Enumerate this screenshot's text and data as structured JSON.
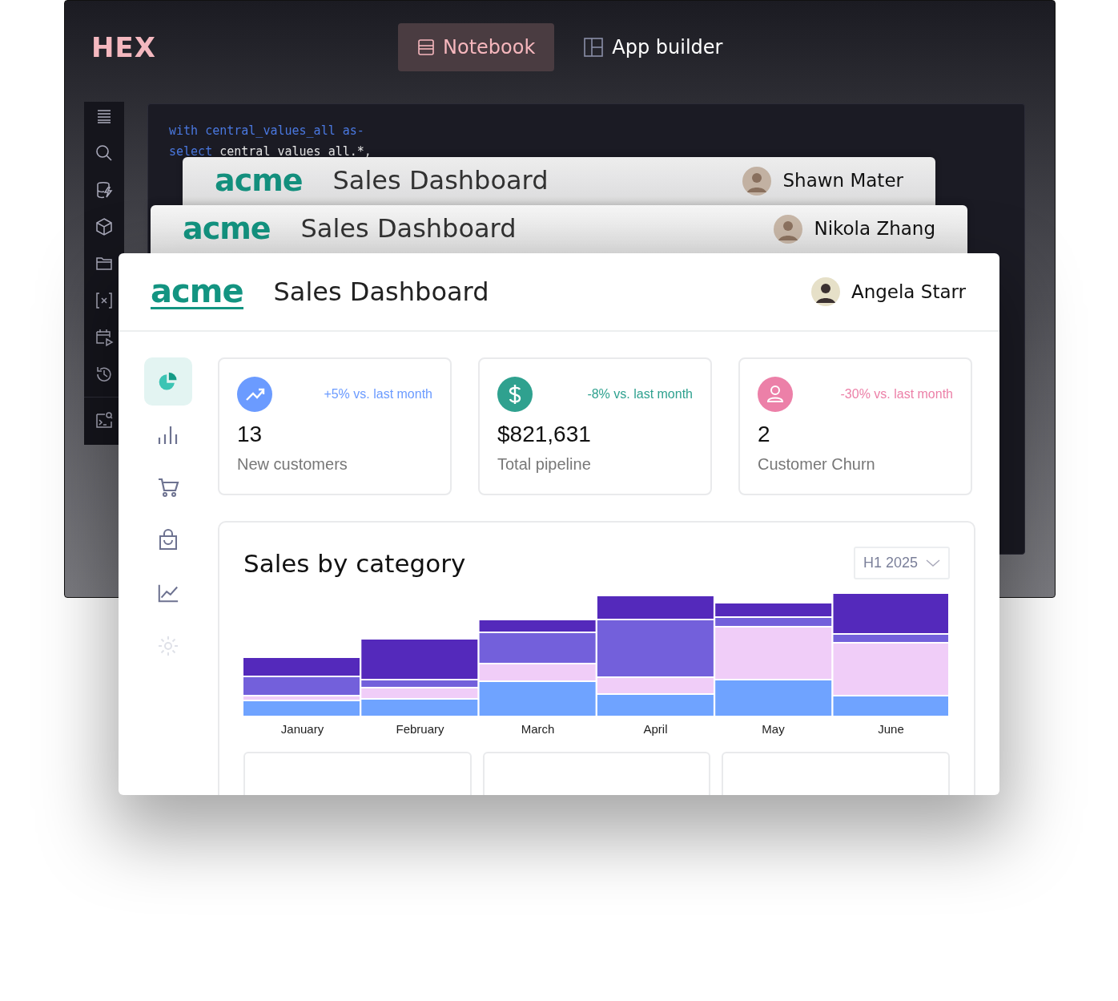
{
  "app": {
    "logo": "HEX",
    "tabs": [
      {
        "label": "Notebook",
        "selected": true
      },
      {
        "label": "App builder",
        "selected": false
      }
    ],
    "code_lines": [
      {
        "keyword": "with",
        "rest": "central_values_all as-"
      },
      {
        "keyword": "select",
        "rest": "central_values_all.*,"
      }
    ]
  },
  "stacked_windows": [
    {
      "logo": "acme",
      "title": "Sales Dashboard",
      "user": "Shawn Mater"
    },
    {
      "logo": "acme",
      "title": "Sales Dashboard",
      "user": "Nikola Zhang"
    }
  ],
  "dashboard": {
    "logo": "acme",
    "title": "Sales Dashboard",
    "user": "Angela Starr",
    "nav": [
      {
        "kind": "pie",
        "selected": true,
        "disabled": false
      },
      {
        "kind": "bars",
        "selected": false,
        "disabled": false
      },
      {
        "kind": "cart",
        "selected": false,
        "disabled": false
      },
      {
        "kind": "bag",
        "selected": false,
        "disabled": false
      },
      {
        "kind": "line",
        "selected": false,
        "disabled": false
      },
      {
        "kind": "gear",
        "selected": false,
        "disabled": true
      }
    ],
    "stats": [
      {
        "kind": "trend",
        "color": "#6b9bff",
        "change": "+5% vs. last month",
        "value": "13",
        "label": "New customers"
      },
      {
        "kind": "dollar",
        "color": "#2fa18f",
        "change": "-8% vs. last month",
        "value": "$821,631",
        "label": "Total pipeline"
      },
      {
        "kind": "person",
        "color": "#ec80a8",
        "change": "-30% vs. last month",
        "value": "2",
        "label": "Customer Churn"
      }
    ],
    "chart_panel": {
      "title": "Sales by category",
      "period": "H1 2025",
      "months": [
        "January",
        "February",
        "March",
        "April",
        "May",
        "June"
      ]
    }
  }
}
